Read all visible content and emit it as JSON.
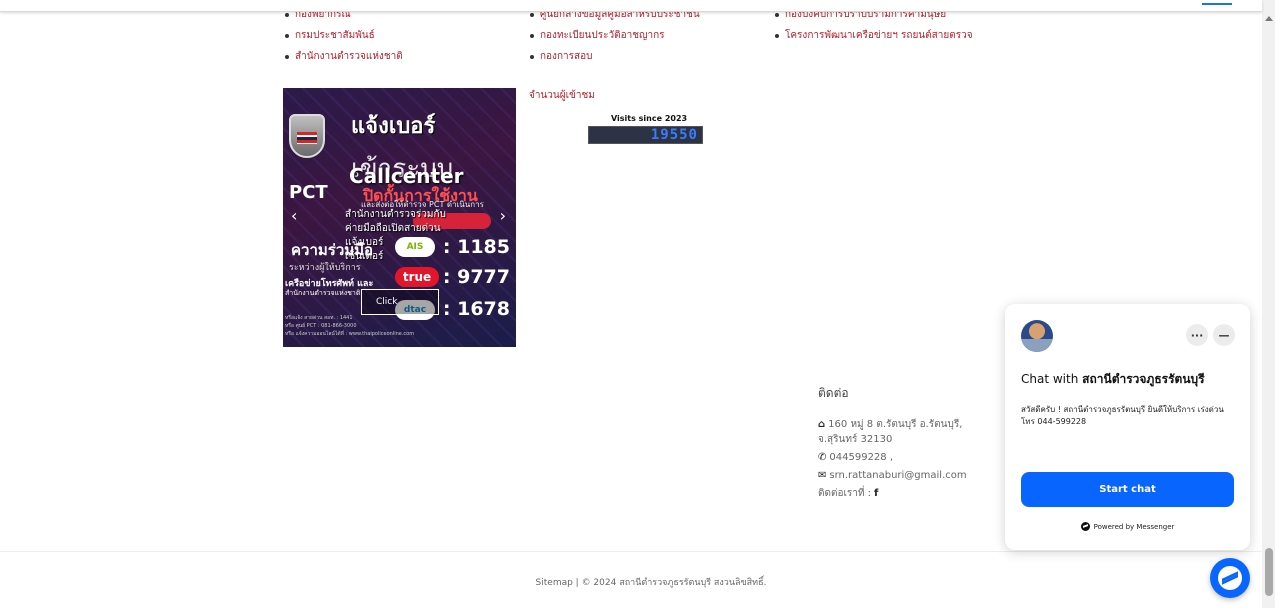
{
  "links": {
    "col1": [
      "กองพยากรณ์",
      "กรมประชาสัมพันธ์",
      "สำนักงานตำรวจแห่งชาติ"
    ],
    "col2": [
      "ศูนย์กลางข้อมูลคู่มือสำหรับประชาชน",
      "กองทะเบียนประวัติอาชญากร",
      "กองการสอบ"
    ],
    "col3": [
      "กองบังคับการปราบปรามการค้ามนุษย์",
      "โครงการพัฒนาเครือข่ายฯ รถยนต์สายตรวจ"
    ]
  },
  "banner": {
    "logo_text": "PCT",
    "headline": "แจ้งเบอร์",
    "headline2": "เข้าระบบ",
    "callcenter": "Callcenter",
    "red_text": "ปิดกั้นการใช้งาน",
    "sub_text": "และส่งต่อให้ตำรวจ PCT ดำเนินการ",
    "overlay_lines": [
      "สำนักงานตำรวจร่วมกับ",
      "ค่ายมือถือเปิดสายด่วน",
      "แจ้งเบอร์",
      "เซ็นเตอร์"
    ],
    "coop": "ความร่วมมือ",
    "coop_sub": "ระหว่างผู้ให้บริการ",
    "network": "เครือข่ายโทรศัพท์ และ",
    "network2": "สำนักงานตำรวจแห่งชาติ",
    "operators": [
      {
        "name": "AIS",
        "number": ": 1185"
      },
      {
        "name": "true",
        "number": ": 9777"
      },
      {
        "name": "dtac",
        "number": ": 1678"
      }
    ],
    "click_label": "Click",
    "fine_print": [
      "หรือแจ้ง สายด่วน สอท. : 1441",
      "หรือ ศูนย์ PCT : 081-866-3000",
      "หรือ แจ้งความออนไลน์ได้ที่ : www.thaipoliceonline.com"
    ],
    "prev_arrow": "‹",
    "next_arrow": "›"
  },
  "visitors": {
    "label": "จำนวนผู้เข้าชม",
    "counter_title": "Visits since 2023",
    "count": "19550"
  },
  "contact": {
    "heading": "ติดต่อ",
    "address": "160 หมู่ 8 ต.รัตนบุรี อ.รัตนบุรี, จ.สุรินทร์ 32130",
    "phone": "044599228 ,",
    "email": "srn.rattanaburi@gmail.com",
    "follow": "ติดต่อเราที่ :"
  },
  "footer": {
    "text": "Sitemap | © 2024 สถานีตำรวจภูธรรัตนบุรี สงวนลิขสิทธิ์."
  },
  "chat": {
    "title_prefix": "Chat with",
    "title_name": "สถานีตำรวจภูธรรัตนบุรี",
    "greeting": "สวัสดีครับ ! สถานีตำรวจภูธรรัตนบุรี ยินดีให้บริการ เร่งด่วนโทร 044-599228",
    "start_button": "Start chat",
    "powered_by": "Powered by Messenger",
    "more_glyph": "···",
    "min_glyph": "—"
  },
  "icons": {
    "home": "⌂",
    "phone": "✆",
    "mail": "✉",
    "facebook": "f"
  },
  "colors": {
    "link_red": "#b3202a",
    "messenger_blue": "#0866ff"
  }
}
